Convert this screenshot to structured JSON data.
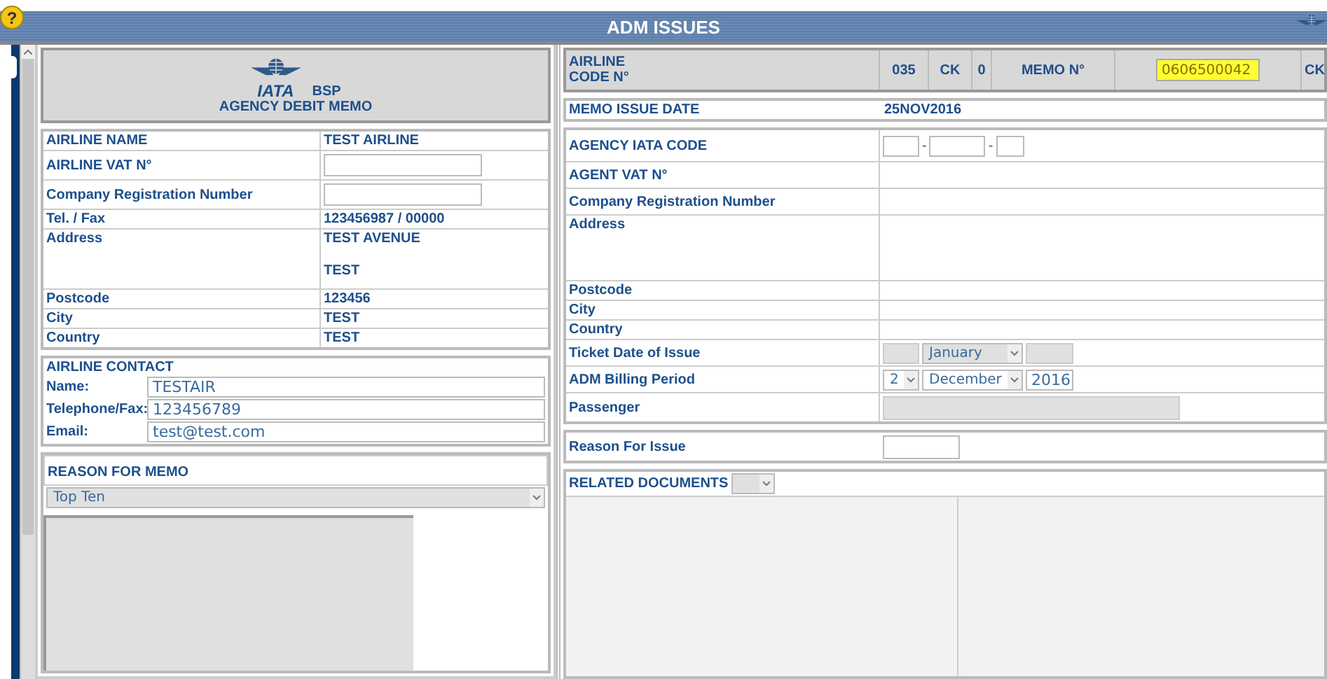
{
  "window": {
    "title": "ADM ISSUES",
    "help": "?"
  },
  "header": {
    "logo_text": "IATA",
    "brand": "BSP",
    "subtitle": "AGENCY DEBIT MEMO"
  },
  "airline_rows": [
    {
      "label": "AIRLINE NAME",
      "kind": "text",
      "value": "TEST AIRLINE"
    },
    {
      "label": "AIRLINE VAT N°",
      "kind": "input"
    },
    {
      "label": "Company Registration Number",
      "kind": "input"
    },
    {
      "label": "Tel. / Fax",
      "kind": "text",
      "value": "123456987 / 00000"
    },
    {
      "label": "Address",
      "kind": "lines",
      "lines": [
        "TEST AVENUE",
        "TEST"
      ]
    },
    {
      "label": "Postcode",
      "kind": "text",
      "value": "123456"
    },
    {
      "label": "City",
      "kind": "text",
      "value": "TEST"
    },
    {
      "label": "Country",
      "kind": "text",
      "value": "TEST"
    }
  ],
  "contact": {
    "title": "AIRLINE CONTACT",
    "fields": [
      {
        "label": "Name:",
        "value": "TESTAIR"
      },
      {
        "label": "Telephone/Fax:",
        "value": "123456789"
      },
      {
        "label": "Email:",
        "value": "test@test.com"
      }
    ]
  },
  "reason_memo": {
    "title": "REASON FOR MEMO",
    "selected_option": "Top Ten"
  },
  "code_bar": {
    "label": "AIRLINE CODE N°",
    "code": "035",
    "check_label": "CK",
    "check": "0",
    "memo_label": "MEMO N°",
    "memo_number": "0606500042",
    "memo_check_label": "CK"
  },
  "issue_date": {
    "label": "MEMO ISSUE DATE",
    "value": "25NOV2016"
  },
  "agency_rows": [
    {
      "label": "AGENCY IATA CODE",
      "kind": "code_inputs",
      "separator": "-"
    },
    {
      "label": "AGENT VAT N°",
      "kind": "blank"
    },
    {
      "label": "Company Registration Number",
      "kind": "blank"
    },
    {
      "label": "Address",
      "kind": "tall"
    },
    {
      "label": "Postcode",
      "kind": "small"
    },
    {
      "label": "City",
      "kind": "small"
    },
    {
      "label": "Country",
      "kind": "small"
    },
    {
      "label": "Ticket Date of Issue",
      "kind": "date",
      "disabled": true,
      "fields": [
        {
          "kind": "input"
        },
        {
          "kind": "select",
          "value": "January"
        },
        {
          "kind": "input"
        }
      ]
    },
    {
      "label": "ADM Billing Period",
      "kind": "date",
      "disabled": false,
      "fields": [
        {
          "kind": "select",
          "value": "2"
        },
        {
          "kind": "select",
          "value": "December"
        },
        {
          "kind": "input",
          "value": "2016"
        }
      ]
    },
    {
      "label": "Passenger",
      "kind": "wide_input",
      "disabled": true
    }
  ],
  "reason_issue": {
    "label": "Reason For Issue"
  },
  "related": {
    "label": "RELATED DOCUMENTS"
  }
}
